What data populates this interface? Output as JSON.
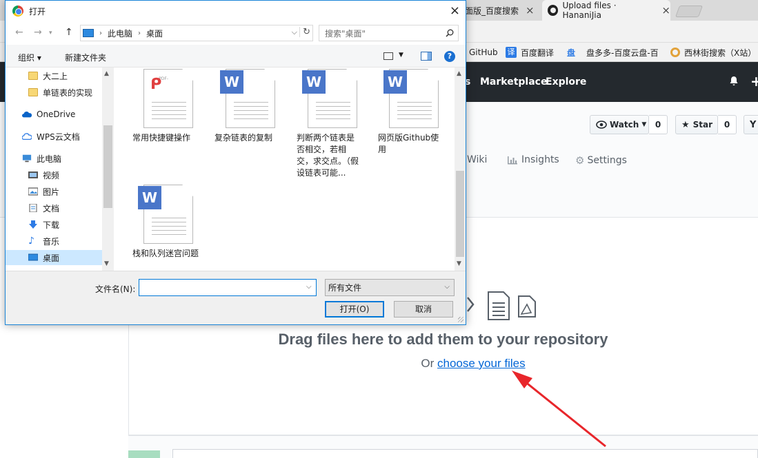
{
  "browser": {
    "tabs": [
      {
        "title": "面版_百度搜索",
        "close": "×"
      },
      {
        "title": "Upload files · HananiJia",
        "close": "×"
      }
    ],
    "bookmarks": [
      {
        "label": "GitHub",
        "icon": "github-icon"
      },
      {
        "label": "百度翻译",
        "icon_text": "译",
        "color": "#2d7be5"
      },
      {
        "label": "盘",
        "icon": "baidu-pan-icon",
        "color": "#2d7be5"
      },
      {
        "label": "盘多多-百度云盘-百",
        "icon": "panduoduo-icon"
      },
      {
        "label": "西林街搜索（X站）",
        "icon": "xilinjie-icon"
      }
    ]
  },
  "github": {
    "nav": [
      "s",
      "Marketplace",
      "Explore"
    ],
    "watch": {
      "label": "Watch",
      "count": "0"
    },
    "star": {
      "label": "Star",
      "count": "0"
    },
    "tabs": [
      "Wiki",
      "Insights",
      "Settings"
    ],
    "drop_title": "Drag files here to add them to your repository",
    "drop_or": "Or",
    "drop_link": "choose your files"
  },
  "dialog": {
    "title": "打开",
    "close": "×",
    "address": [
      "此电脑",
      "桌面"
    ],
    "search_placeholder": "搜索\"桌面\"",
    "toolbar": {
      "organize": "组织 ▾",
      "new_folder": "新建文件夹",
      "help": "?"
    },
    "tree": [
      {
        "label": "大二上",
        "icon": "folder-icon"
      },
      {
        "label": "单链表的实现",
        "icon": "folder-icon"
      },
      {
        "label": "OneDrive",
        "icon": "onedrive-icon"
      },
      {
        "label": "WPS云文档",
        "icon": "wps-cloud-icon"
      },
      {
        "label": "此电脑",
        "icon": "this-pc-icon"
      },
      {
        "label": "视频",
        "icon": "video-icon"
      },
      {
        "label": "图片",
        "icon": "pictures-icon"
      },
      {
        "label": "文档",
        "icon": "documents-icon"
      },
      {
        "label": "下载",
        "icon": "downloads-icon"
      },
      {
        "label": "音乐",
        "icon": "music-icon"
      },
      {
        "label": "桌面",
        "icon": "desktop-icon",
        "selected": true
      }
    ],
    "files": [
      {
        "label": "常用快捷键操作",
        "type": "pdf",
        "badge": "-PDF-"
      },
      {
        "label": "复杂链表的复制",
        "type": "wps",
        "badge": "W"
      },
      {
        "label": "判断两个链表是否相交，若相交，求交点。（假设链表可能...",
        "type": "wps",
        "badge": "W"
      },
      {
        "label": "网页版Github使用",
        "type": "wps",
        "badge": "W"
      },
      {
        "label": "栈和队列迷宫问题",
        "type": "wps",
        "badge": "W"
      }
    ],
    "filename_label": "文件名(N):",
    "filename_value": "",
    "filetype": "所有文件",
    "open_button": "打开(O)",
    "cancel_button": "取消"
  },
  "colors": {
    "gh_header": "#24292e",
    "link": "#0366d6",
    "arrow": "#e8262b",
    "dialog_border": "#1883d7",
    "selected": "#cce8ff"
  }
}
